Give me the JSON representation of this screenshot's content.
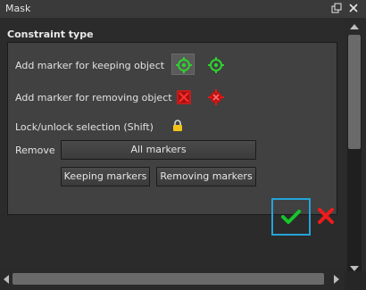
{
  "window": {
    "title": "Mask",
    "float_icon": "float-window-icon",
    "close_icon": "close-icon"
  },
  "constraint": {
    "group_title": "Constraint type",
    "keep_label": "Add marker for keeping object",
    "remove_obj_label": "Add marker for removing object",
    "lock_label": "Lock/unlock selection (Shift)",
    "remove_label": "Remove",
    "all_markers": "All markers",
    "keeping_markers": "Keeping markers",
    "removing_markers": "Removing markers"
  },
  "icons": {
    "keep_marker": "green-target-icon",
    "remove_marker": "red-target-icon",
    "lock": "lock-icon",
    "ok": "green-checkmark-icon",
    "cancel": "red-x-icon"
  },
  "colors": {
    "keep": "#2fd12f",
    "remove": "#e01818",
    "lock": "#f2c21a",
    "ok_outline": "#25a3d8"
  }
}
